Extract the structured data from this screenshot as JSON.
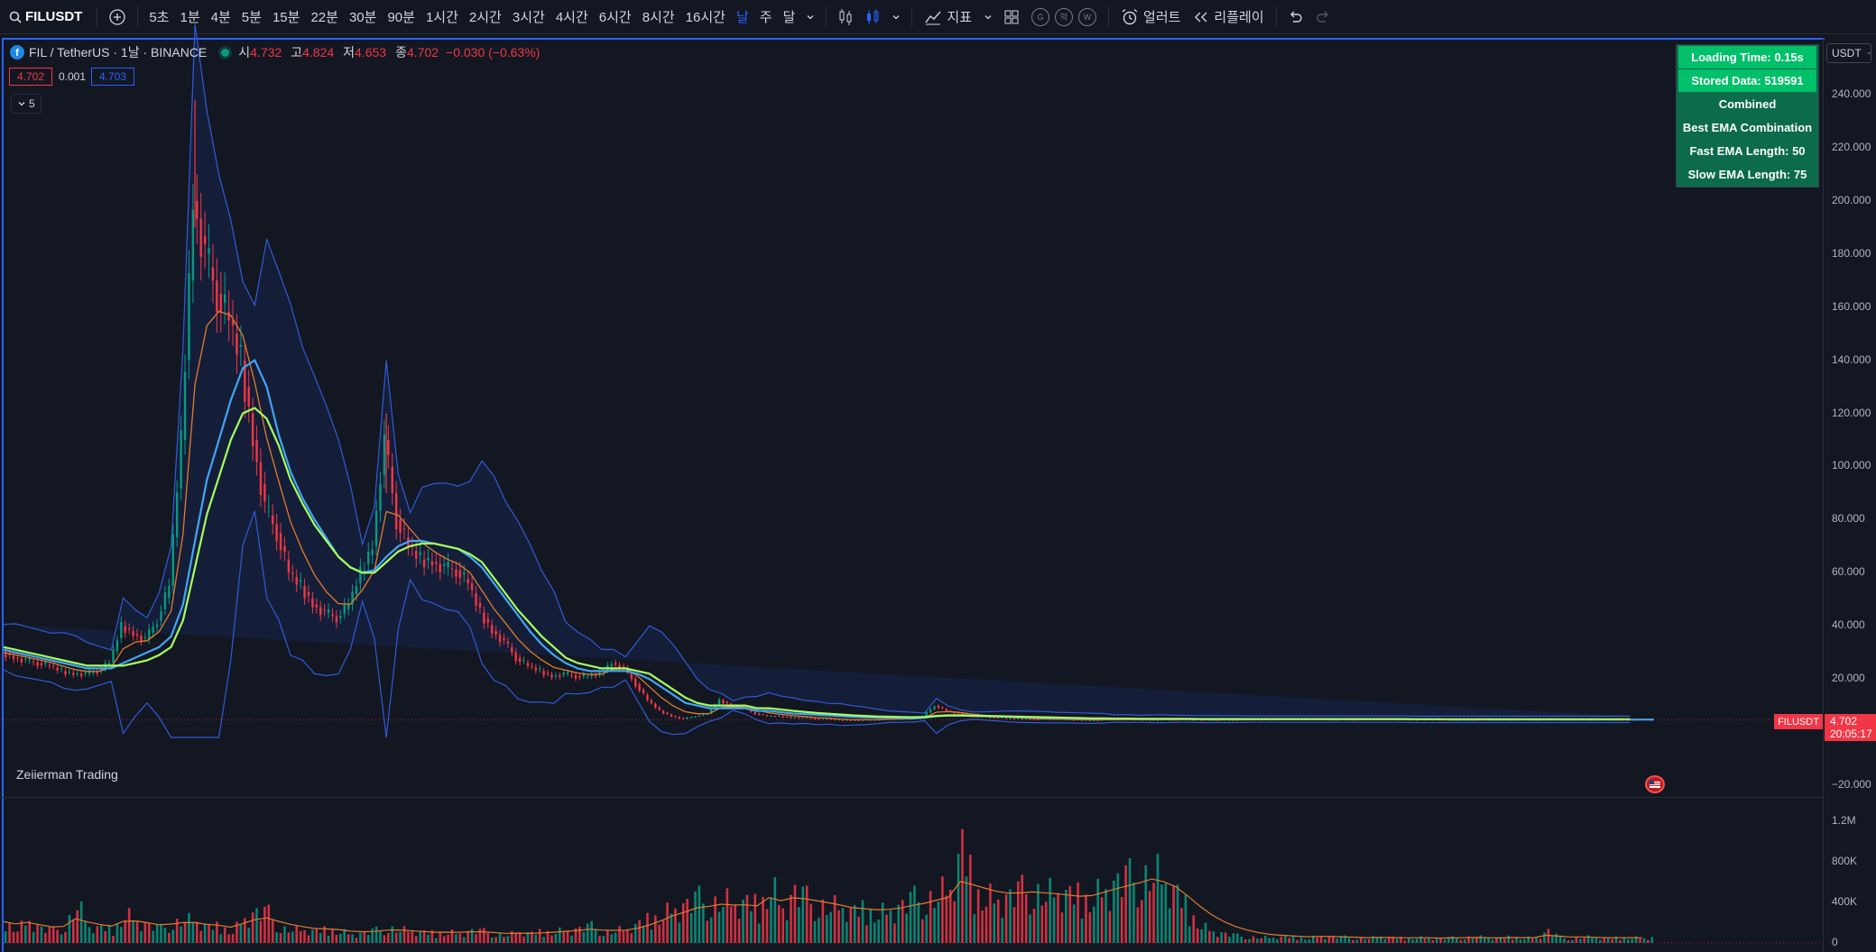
{
  "toolbar": {
    "symbol": "FILUSDT",
    "timeframes": [
      "5초",
      "1분",
      "4분",
      "5분",
      "15분",
      "22분",
      "30분",
      "90분",
      "1시간",
      "2시간",
      "3시간",
      "4시간",
      "6시간",
      "8시간",
      "16시간",
      "날",
      "주",
      "달"
    ],
    "active_timeframe": "날",
    "indicators_label": "지표",
    "badges": [
      "G",
      "막",
      "W"
    ],
    "alert_label": "얼러트",
    "replay_label": "리플레이"
  },
  "legend": {
    "title": "FIL / TetherUS · 1날 · BINANCE",
    "open_label": "시",
    "open": "4.732",
    "high_label": "고",
    "high": "4.824",
    "low_label": "저",
    "low": "4.653",
    "close_label": "종",
    "close": "4.702",
    "change": "−0.030 (−0.63%)",
    "bid": "4.702",
    "spread": "0.001",
    "ask": "4.703",
    "collapse_count": "5"
  },
  "watermark": "Zeiierman Trading",
  "info_table": [
    {
      "text": "Loading Time: 0.15s",
      "style": "bright"
    },
    {
      "text": "Stored Data: 519591",
      "style": "bright"
    },
    {
      "text": "Combined",
      "style": "dark"
    },
    {
      "text": "Best EMA Combination",
      "style": "dark"
    },
    {
      "text": "Fast EMA Length: 50",
      "style": "dark"
    },
    {
      "text": "Slow EMA Length: 75",
      "style": "dark"
    }
  ],
  "price_axis": {
    "currency": "USDT",
    "ticks": [
      "240.000",
      "220.000",
      "200.000",
      "180.000",
      "160.000",
      "140.000",
      "120.000",
      "100.000",
      "80.000",
      "60.000",
      "40.000",
      "20.000",
      "−20.000"
    ],
    "last_symbol": "FILUSDT",
    "last_price": "4.702",
    "countdown": "20:05:17"
  },
  "volume_axis": {
    "ticks": [
      "1.2M",
      "800K",
      "400K",
      "0"
    ]
  },
  "colors": {
    "background": "#131722",
    "up": "#089981",
    "down": "#f23645",
    "accent": "#2962ff",
    "fast_ema": "#42a5f5",
    "slow_ema": "#a5ff5f",
    "ema_short": "#e07b2e",
    "band": "#2f5bd8",
    "table_bright": "#00c06a",
    "table_dark": "#0b6b4a"
  },
  "chart_data": {
    "type": "line",
    "title": "FIL / TetherUS · 1날 · BINANCE",
    "ylim": [
      -20,
      250
    ],
    "x": [
      0,
      10,
      20,
      30,
      40,
      50,
      60,
      70,
      80,
      90,
      100,
      110,
      120,
      130,
      140,
      150,
      160,
      170,
      180,
      190,
      200,
      210,
      220,
      230,
      240,
      250,
      260,
      270,
      280,
      290,
      300,
      310,
      320,
      330,
      340,
      350,
      360,
      370,
      380,
      390,
      400,
      410,
      420,
      430,
      440,
      450,
      460,
      470,
      480,
      490,
      500,
      510,
      520,
      530,
      540,
      550,
      560,
      570,
      580,
      590,
      600,
      610,
      620,
      630,
      640,
      650,
      660,
      670,
      680,
      690,
      700,
      710,
      720,
      730,
      740,
      750,
      760,
      770,
      780,
      790,
      800,
      810,
      820,
      830,
      840,
      850,
      860,
      870,
      880,
      890,
      900,
      910,
      920,
      930,
      940,
      950,
      960,
      970,
      980,
      990,
      1000,
      1010,
      1020,
      1030,
      1040,
      1050,
      1060,
      1070,
      1080,
      1090,
      1100,
      1110,
      1120,
      1130,
      1140,
      1150,
      1160,
      1170,
      1180,
      1190,
      1200,
      1210,
      1220,
      1230,
      1240,
      1250,
      1260,
      1270,
      1280,
      1290,
      1300,
      1310,
      1320,
      1330,
      1340,
      1350,
      1360,
      1370,
      1380
    ],
    "series": [
      {
        "name": "close",
        "values": [
          30,
          28,
          27,
          26,
          25,
          23,
          22,
          22,
          23,
          26,
          40,
          37,
          35,
          42,
          55,
          110,
          200,
          180,
          165,
          155,
          140,
          110,
          85,
          75,
          60,
          55,
          48,
          45,
          43,
          48,
          60,
          70,
          110,
          80,
          70,
          65,
          64,
          62,
          61,
          56,
          45,
          38,
          34,
          28,
          25,
          23,
          21,
          22,
          21,
          21,
          22,
          26,
          24,
          18,
          12,
          8,
          6,
          5,
          6,
          7,
          12,
          10,
          9,
          7,
          6,
          6,
          5.5,
          5.5,
          5,
          5,
          4.5,
          4.5,
          4.5,
          4.7,
          5,
          5,
          5,
          6,
          10,
          8,
          7,
          6,
          5.8,
          5.5,
          5.2,
          5,
          4.9,
          4.8,
          4.8,
          4.7,
          4.6,
          4.5,
          4.6,
          4.8,
          4.7,
          4.7,
          4.6,
          4.6,
          4.7,
          4.7,
          4.6,
          4.6,
          4.6,
          4.6,
          4.7,
          4.7,
          4.7,
          4.8,
          4.8,
          4.8,
          4.8,
          4.7,
          4.7,
          4.7,
          4.8,
          4.8,
          4.8,
          4.7,
          4.7,
          4.7,
          4.7,
          4.7,
          4.7,
          4.7,
          4.7,
          4.7,
          4.7,
          4.7,
          4.7,
          4.7,
          4.7,
          4.7,
          4.7,
          4.7,
          4.7,
          4.7,
          4.7,
          4.7,
          4.702
        ]
      },
      {
        "name": "fast_ema",
        "values": [
          31,
          30,
          29,
          28,
          27,
          26,
          25,
          24,
          24,
          24,
          26,
          28,
          30,
          32,
          36,
          48,
          72,
          95,
          110,
          125,
          137,
          140,
          130,
          112,
          98,
          88,
          80,
          73,
          66,
          62,
          60,
          61,
          66,
          70,
          72,
          72,
          71,
          70,
          69,
          66,
          62,
          56,
          50,
          44,
          38,
          33,
          29,
          26,
          24,
          23,
          23,
          23,
          23,
          22,
          20,
          17,
          14,
          11,
          10,
          9,
          9,
          9,
          9,
          8,
          8,
          7.5,
          7,
          6.8,
          6.5,
          6.3,
          6,
          5.8,
          5.6,
          5.5,
          5.4,
          5.3,
          5.2,
          5.4,
          6,
          6.2,
          6.2,
          6.1,
          6,
          5.9,
          5.8,
          5.6,
          5.5,
          5.4,
          5.3,
          5.2,
          5.1,
          5,
          5,
          5,
          5,
          4.9,
          4.9,
          4.9,
          4.9,
          4.9,
          4.8,
          4.8,
          4.8,
          4.8,
          4.8,
          4.8,
          4.8,
          4.8,
          4.8,
          4.8,
          4.8,
          4.8,
          4.8,
          4.8,
          4.8,
          4.8,
          4.8,
          4.8,
          4.8,
          4.8,
          4.8,
          4.7,
          4.7,
          4.7,
          4.7,
          4.7,
          4.7,
          4.7,
          4.7,
          4.7,
          4.7,
          4.7,
          4.7,
          4.7,
          4.7,
          4.7,
          4.7,
          4.7,
          4.7
        ]
      },
      {
        "name": "slow_ema",
        "values": [
          32,
          31,
          30,
          29,
          28,
          27,
          26,
          25,
          25,
          25,
          25,
          26,
          27,
          29,
          32,
          42,
          62,
          82,
          96,
          110,
          120,
          122,
          118,
          108,
          95,
          86,
          78,
          72,
          66,
          62,
          60,
          60,
          64,
          68,
          70,
          71,
          71,
          70,
          69,
          67,
          64,
          58,
          52,
          46,
          41,
          36,
          32,
          28,
          26,
          25,
          24,
          24,
          24,
          23,
          22,
          19,
          16,
          13,
          11,
          10,
          10,
          10,
          10,
          9,
          9,
          8.5,
          8,
          7.6,
          7.2,
          6.9,
          6.6,
          6.3,
          6.1,
          5.9,
          5.8,
          5.7,
          5.6,
          5.7,
          6.1,
          6.3,
          6.3,
          6.2,
          6.1,
          6,
          5.9,
          5.8,
          5.7,
          5.6,
          5.5,
          5.4,
          5.3,
          5.2,
          5.2,
          5.1,
          5.1,
          5,
          5,
          5,
          5,
          5,
          4.9,
          4.9,
          4.9,
          4.9,
          4.9,
          4.9,
          4.9,
          4.9,
          4.9,
          4.9,
          4.9,
          4.9,
          4.9,
          4.9,
          4.9,
          4.9,
          4.9,
          4.9,
          4.8,
          4.8,
          4.8,
          4.8,
          4.8,
          4.8,
          4.8,
          4.8,
          4.8,
          4.8,
          4.8,
          4.8,
          4.8,
          4.8,
          4.8,
          4.8,
          4.8,
          4.8,
          4.8
        ]
      }
    ],
    "volume_max": 1300000,
    "volume": [
      210000,
      150000,
      230000,
      140000,
      120000,
      170000,
      380000,
      150000,
      140000,
      130000,
      300000,
      230000,
      170000,
      140000,
      200000,
      230000,
      200000,
      150000,
      160000,
      120000,
      260000,
      300000,
      280000,
      150000,
      130000,
      120000,
      110000,
      130000,
      120000,
      90000,
      100000,
      120000,
      150000,
      130000,
      110000,
      100000,
      90000,
      110000,
      100000,
      120000,
      110000,
      90000,
      80000,
      100000,
      90000,
      110000,
      120000,
      130000,
      140000,
      160000,
      110000,
      120000,
      130000,
      180000,
      240000,
      300000,
      360000,
      380000,
      420000,
      390000,
      420000,
      360000,
      380000,
      350000,
      600000,
      360000,
      500000,
      420000,
      380000,
      360000,
      330000,
      300000,
      320000,
      310000,
      340000,
      370000,
      420000,
      430000,
      480000,
      500000,
      900000,
      520000,
      480000,
      450000,
      460000,
      500000,
      520000,
      480000,
      470000,
      450000,
      440000,
      480000,
      560000,
      600000,
      620000,
      650000,
      700000,
      560000,
      460000,
      300000,
      180000,
      120000,
      90000,
      70000,
      60000,
      55000,
      50000,
      60000,
      55000,
      50000,
      70000,
      60000,
      55000,
      50000,
      45000,
      60000,
      50000,
      45000,
      55000,
      50000,
      45000,
      50000,
      55000,
      60000,
      50000,
      45000,
      60000,
      50000,
      55000,
      120000,
      50000,
      45000,
      60000,
      50000,
      45000,
      50000,
      55000,
      50000,
      60000
    ]
  }
}
